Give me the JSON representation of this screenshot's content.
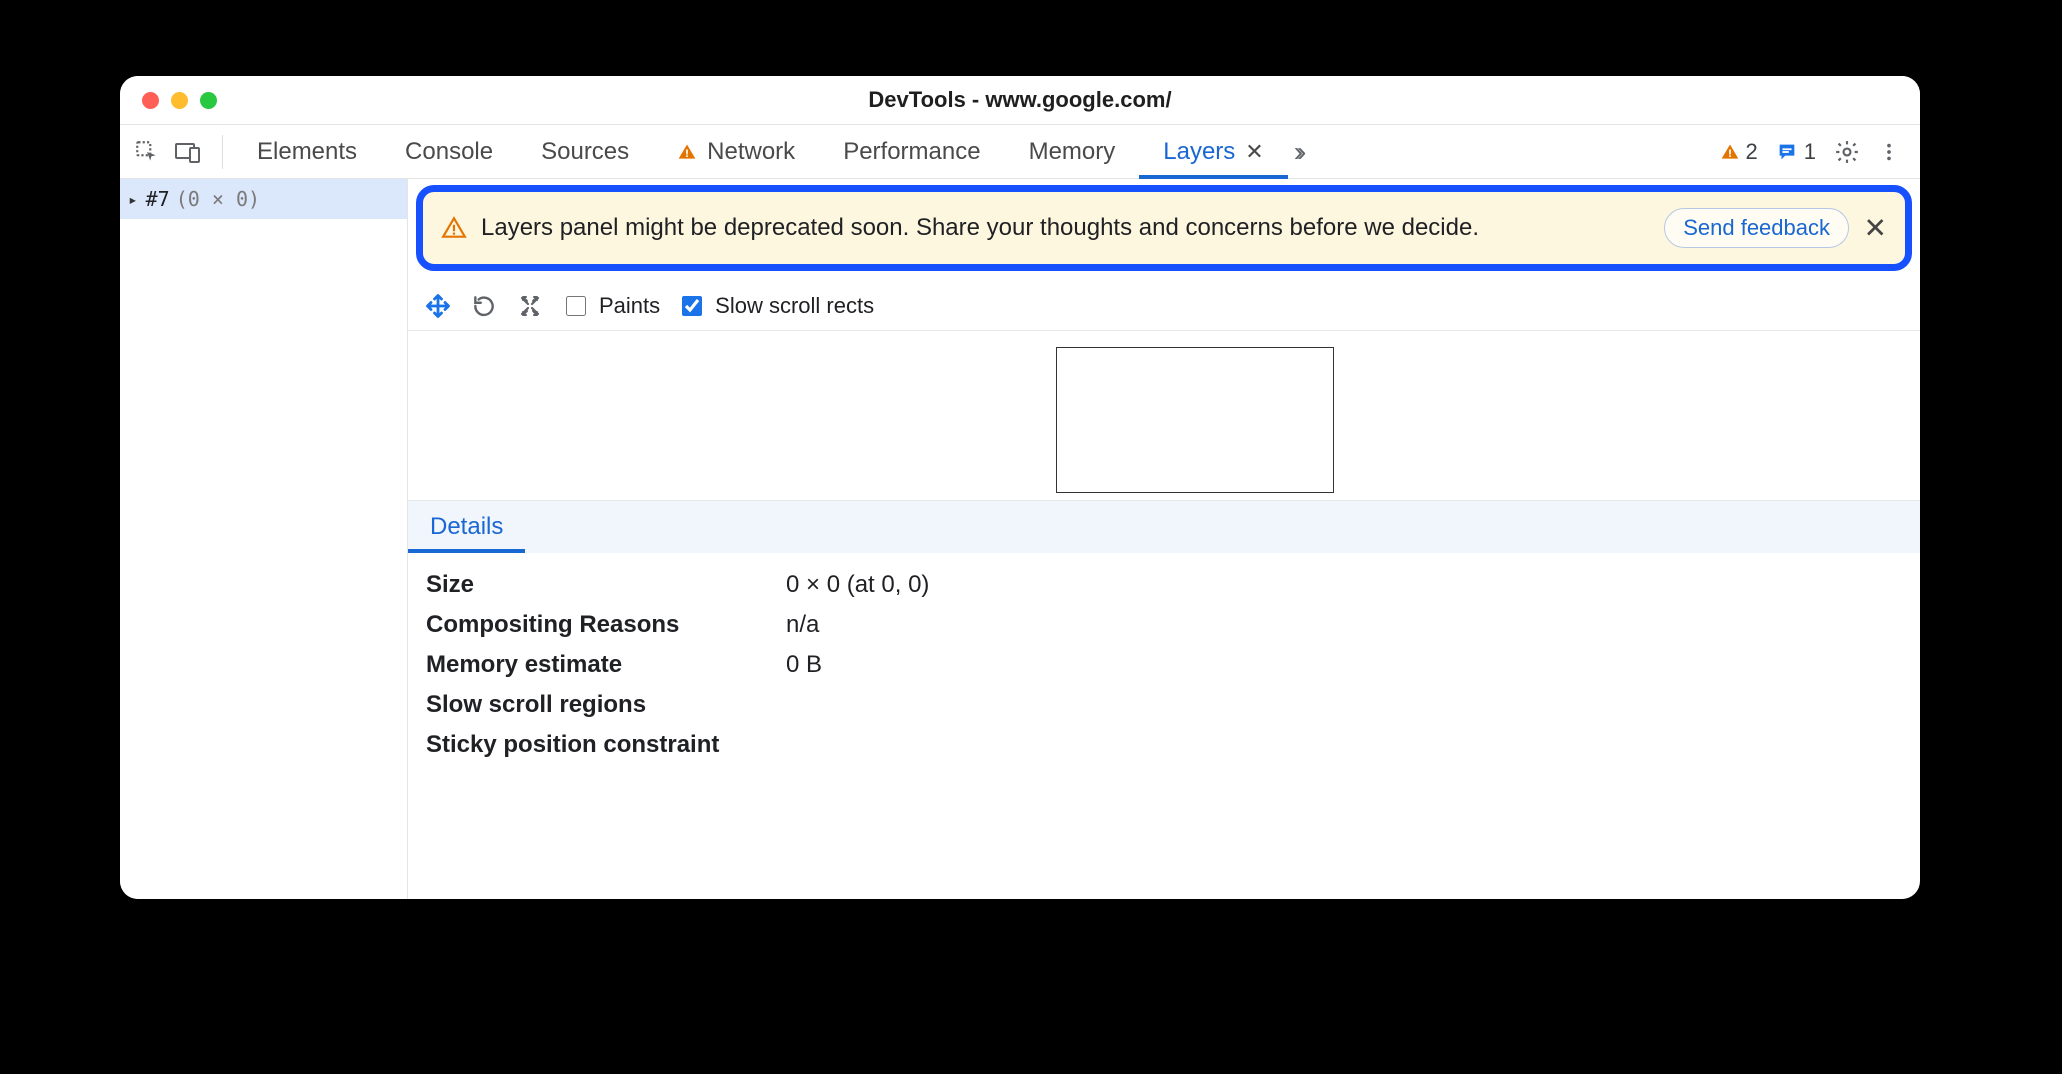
{
  "window": {
    "title": "DevTools - www.google.com/"
  },
  "tabs": {
    "elements": "Elements",
    "console": "Console",
    "sources": "Sources",
    "network": "Network",
    "performance": "Performance",
    "memory": "Memory",
    "layers": "Layers"
  },
  "status": {
    "warnings": "2",
    "messages": "1"
  },
  "sidebar": {
    "node_label": "#7",
    "node_dims": "(0 × 0)"
  },
  "banner": {
    "text": "Layers panel might be deprecated soon. Share your thoughts and concerns before we decide.",
    "feedback": "Send feedback"
  },
  "toolbar": {
    "paints_label": "Paints",
    "paints_checked": false,
    "slow_scroll_label": "Slow scroll rects",
    "slow_scroll_checked": true
  },
  "detailsTab": {
    "label": "Details"
  },
  "details": {
    "size_k": "Size",
    "size_v": "0 × 0 (at 0, 0)",
    "compositing_k": "Compositing Reasons",
    "compositing_v": "n/a",
    "memory_k": "Memory estimate",
    "memory_v": "0 B",
    "slow_scroll_k": "Slow scroll regions",
    "slow_scroll_v": "",
    "sticky_k": "Sticky position constraint",
    "sticky_v": ""
  }
}
